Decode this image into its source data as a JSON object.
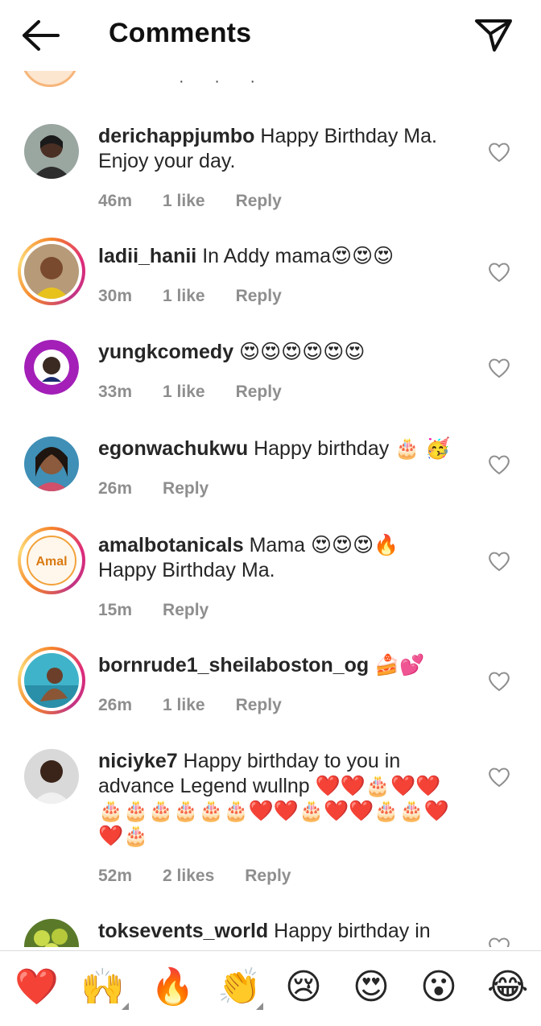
{
  "header": {
    "title": "Comments"
  },
  "partial": {
    "text": "· · ·"
  },
  "comments": [
    {
      "username": "derichappjumbo",
      "text": " Happy Birthday Ma.",
      "text2": "Enjoy your day.",
      "time": "46m",
      "likes": "1 like",
      "reply": "Reply"
    },
    {
      "username": "ladii_hanii",
      "text": " In Addy mama😍😍😍",
      "time": "30m",
      "likes": "1 like",
      "reply": "Reply"
    },
    {
      "username": "yungkcomedy",
      "text": " 😍😍😍😍😍😍",
      "time": "33m",
      "likes": "1 like",
      "reply": "Reply"
    },
    {
      "username": "egonwachukwu",
      "text": " Happy birthday 🎂 🥳",
      "time": "26m",
      "reply": "Reply"
    },
    {
      "username": "amalbotanicals",
      "text": " Mama 😍😍😍🔥",
      "text2": "Happy Birthday Ma.",
      "time": "15m",
      "reply": "Reply",
      "avatar_text": "Amal"
    },
    {
      "username": "bornrude1_sheilaboston_og",
      "text": " 🍰💕",
      "time": "26m",
      "likes": "1 like",
      "reply": "Reply"
    },
    {
      "username": "niciyke7",
      "text": " Happy birthday to you in",
      "text2": "advance Legend wullnp ❤️❤️🎂❤️❤️",
      "text3": "🎂🎂🎂🎂🎂🎂❤️❤️🎂❤️❤️🎂🎂❤️",
      "text4": "❤️🎂",
      "time": "52m",
      "likes": "2 likes",
      "reply": "Reply"
    },
    {
      "username": "toksevents_world",
      "text": " Happy birthday in"
    }
  ],
  "reactions": [
    "❤️",
    "🙌",
    "🔥",
    "👏",
    "😢",
    "😍",
    "😮",
    "😂"
  ],
  "colors": {
    "ring_start": "#f58529",
    "ring_mid": "#dd2a7b",
    "meta": "#8e8e8e",
    "text": "#262626"
  },
  "icons": {
    "back": "arrow-left-icon",
    "send": "paper-plane-icon",
    "like": "heart-outline-icon"
  }
}
